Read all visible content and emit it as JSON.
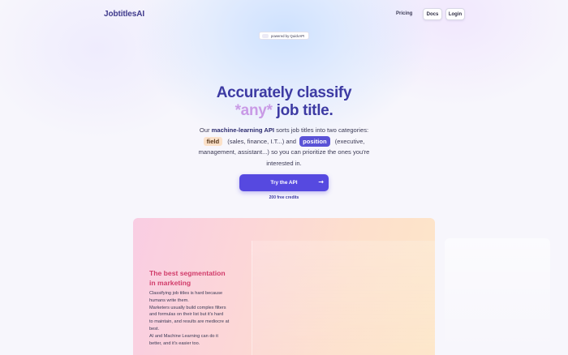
{
  "header": {
    "brand": "JobtitlesAI",
    "nav": {
      "pricing": "Pricing",
      "docs": "Docs",
      "login": "Login"
    },
    "powered_by": "powered by QuickAPI"
  },
  "hero": {
    "title_line1": "Accurately classify",
    "title_any": "*any*",
    "title_rest": "job title.",
    "desc_prefix": "Our",
    "desc_bold": "machine-learning API",
    "desc_mid": "sorts job titles into two categories:",
    "pill_field": "field",
    "desc_field_examples": "(sales, finance, I.T...) and",
    "pill_position": "position",
    "desc_position_examples": "(executive, management, assistant...) so you can prioritize the ones you're interested in.",
    "cta_label": "Try the API",
    "cta_arrow": "→",
    "credits": "200 free credits"
  },
  "card": {
    "title_line1": "The best segmentation",
    "title_line2": "in marketing",
    "lines": [
      "Classifying job titles is hard because",
      "humans write them.",
      "Marketers usually build complex filters",
      "and formulas on their list but it's hard",
      "to maintain, and results are mediocre at",
      "best.",
      "AI and Machine Learning can do it",
      "better, and it's easier too."
    ]
  },
  "colors": {
    "accent": "#5649e0",
    "brand": "#3f3a8c",
    "card_title": "#d13c6a",
    "pill_field_bg": "#fbe1c9"
  }
}
